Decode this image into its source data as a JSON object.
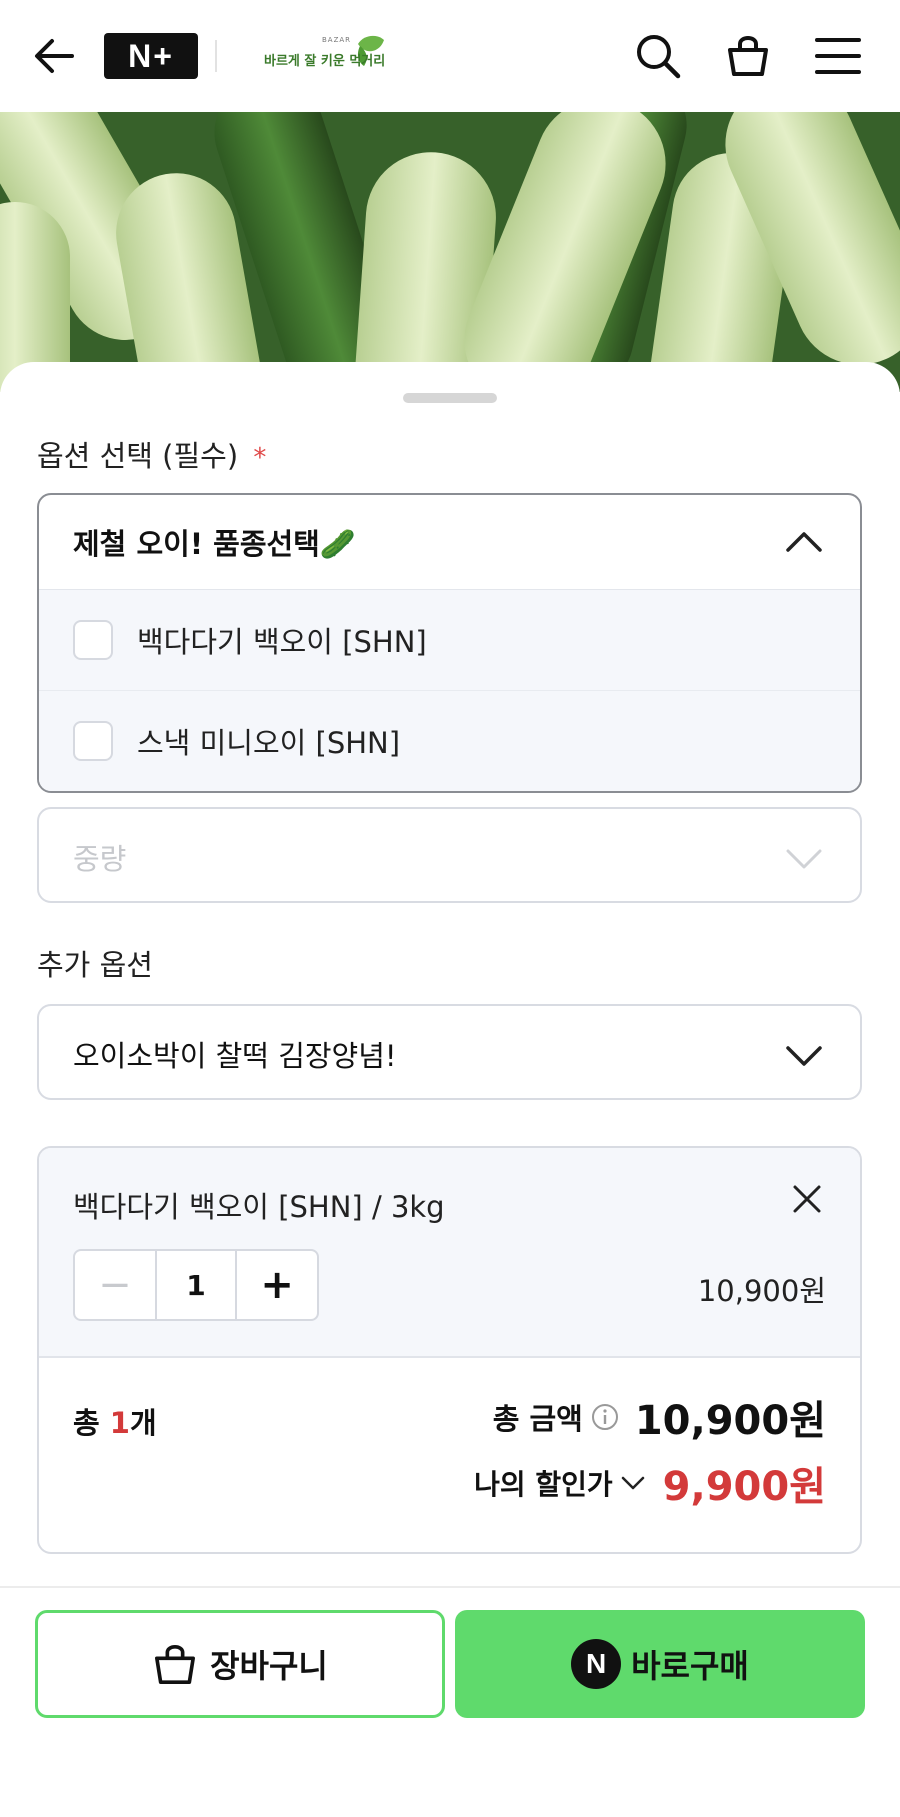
{
  "header": {
    "back_icon": "back-arrow-icon",
    "brand_badge": "N+",
    "logo_text_main": "바르게 잘 키운 먹거리",
    "logo_text_small": "BAZAR",
    "search_icon": "search-icon",
    "cart_icon": "shopping-bag-icon",
    "menu_icon": "hamburger-menu-icon"
  },
  "options": {
    "section_label": "옵션 선택 (필수)",
    "required_mark": "*",
    "dropdown_title": "제철 오이! 품종선택🥒",
    "items": [
      {
        "label": "백다다기 백오이 [SHN]",
        "checked": false
      },
      {
        "label": "스낵 미니오이 [SHN]",
        "checked": false
      }
    ],
    "weight_placeholder": "중량"
  },
  "extra": {
    "section_label": "추가 옵션",
    "selected": "오이소박이 찰떡 김장양념!"
  },
  "cart_item": {
    "name": "백다다기 백오이 [SHN] / 3kg",
    "minus": "−",
    "quantity": "1",
    "plus": "+",
    "price": "10,900원"
  },
  "summary": {
    "count_prefix": "총 ",
    "count": "1",
    "count_suffix": "개",
    "total_label": "총 금액",
    "total_value": "10,900원",
    "discount_label": "나의 할인가",
    "discount_value": "9,900원"
  },
  "actions": {
    "cart_label": "장바구니",
    "buy_label": "바로구매",
    "buy_badge": "N"
  },
  "colors": {
    "accent_green": "#5fda6c",
    "price_red": "#d33a3a"
  }
}
